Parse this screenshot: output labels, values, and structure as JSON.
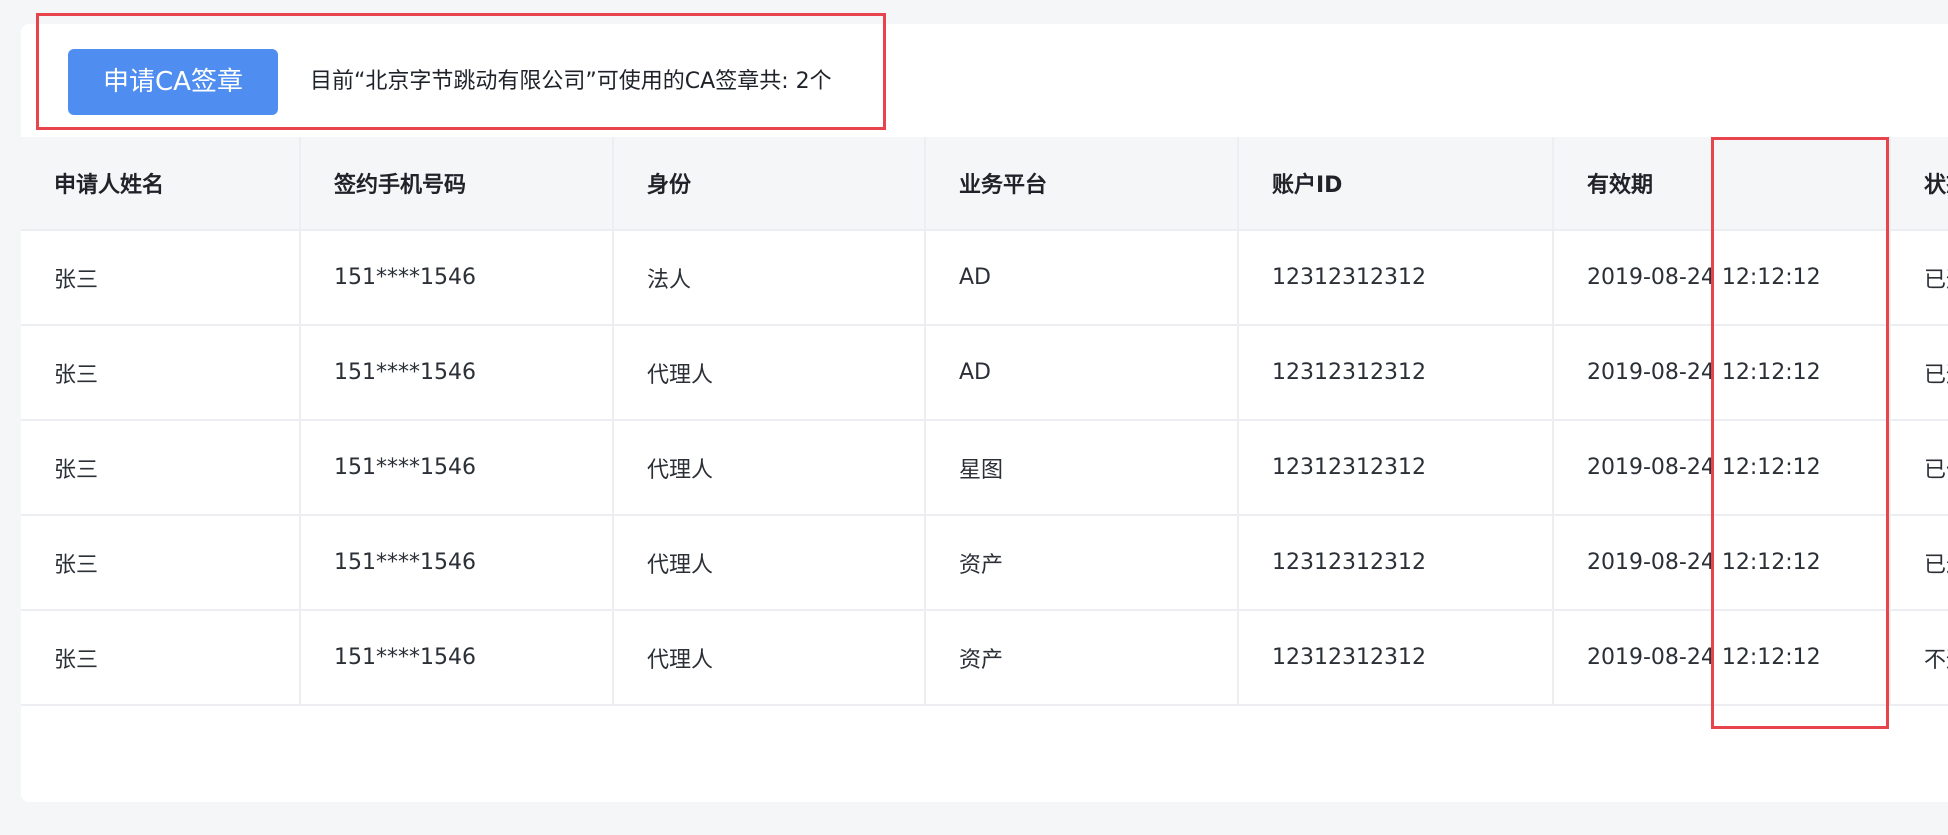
{
  "toolbar": {
    "apply_button_label": "申请CA签章",
    "summary_text": "目前“北京字节跳动有限公司”可使用的CA签章共: 2个"
  },
  "table": {
    "columns": [
      "申请人姓名",
      "签约手机号码",
      "身份",
      "业务平台",
      "账户ID",
      "有效期",
      "状态"
    ],
    "rows": [
      [
        "张三",
        "151****1546",
        "法人",
        "AD",
        "12312312312",
        "2019-08-24 12:12:12",
        "已通过"
      ],
      [
        "张三",
        "151****1546",
        "代理人",
        "AD",
        "12312312312",
        "2019-08-24 12:12:12",
        "已通过"
      ],
      [
        "张三",
        "151****1546",
        "代理人",
        "星图",
        "12312312312",
        "2019-08-24 12:12:12",
        "已作废"
      ],
      [
        "张三",
        "151****1546",
        "代理人",
        "资产",
        "12312312312",
        "2019-08-24 12:12:12",
        "已过期"
      ],
      [
        "张三",
        "151****1546",
        "代理人",
        "资产",
        "12312312312",
        "2019-08-24 12:12:12",
        "不通过"
      ]
    ]
  },
  "colors": {
    "primary_button": "#4f8ef0",
    "annotation_border": "#e8444e",
    "header_background": "#f5f6f8",
    "page_background": "#f5f6f8"
  }
}
